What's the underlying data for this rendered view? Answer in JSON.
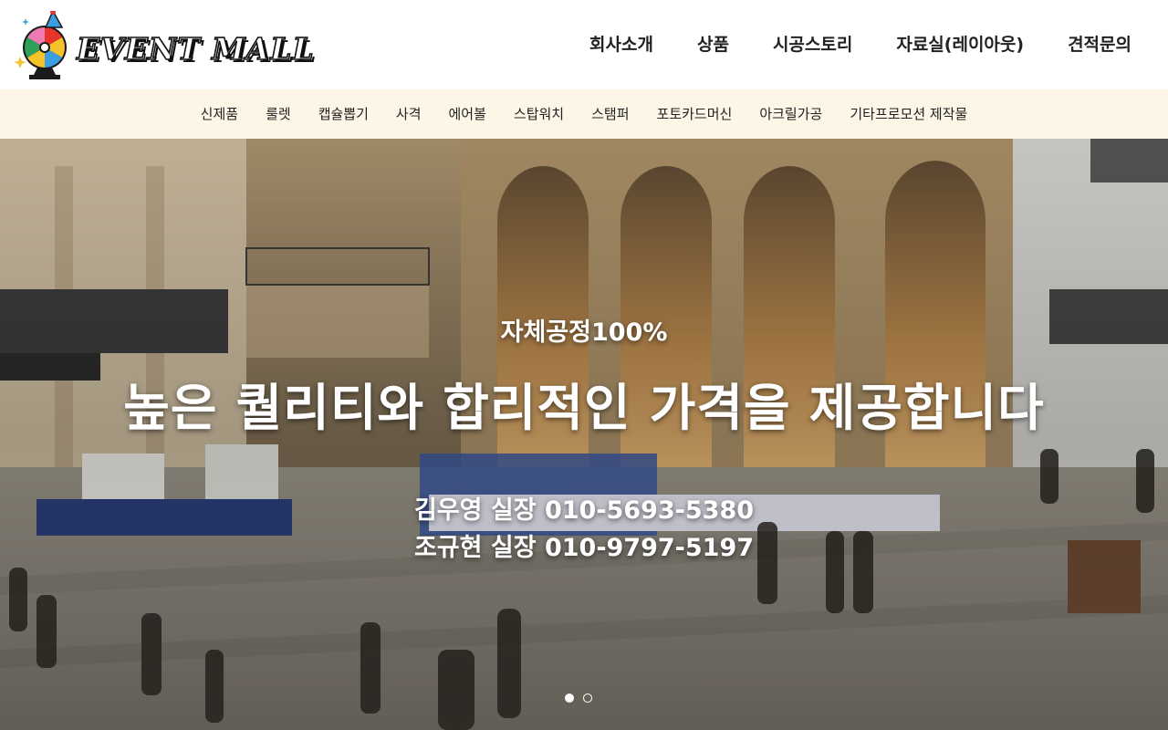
{
  "header": {
    "logo_text": "EVENT MALL",
    "nav": [
      {
        "label": "회사소개"
      },
      {
        "label": "상품"
      },
      {
        "label": "시공스토리"
      },
      {
        "label": "자료실(레이아웃)"
      },
      {
        "label": "견적문의"
      }
    ]
  },
  "subnav": {
    "items": [
      {
        "label": "신제품"
      },
      {
        "label": "룰렛"
      },
      {
        "label": "캡슐뽑기"
      },
      {
        "label": "사격"
      },
      {
        "label": "에어볼"
      },
      {
        "label": "스탑워치"
      },
      {
        "label": "스탬퍼"
      },
      {
        "label": "포토카드머신"
      },
      {
        "label": "아크릴가공"
      },
      {
        "label": "기타프로모션 제작물"
      }
    ]
  },
  "hero": {
    "subtitle": "자체공정100%",
    "title": "높은 퀄리티와 합리적인 가격을 제공합니다",
    "contacts": [
      "김우영 실장 010-5693-5380",
      "조규현 실장 010-9797-5197"
    ],
    "slides_total": 2,
    "active_slide": 1
  },
  "colors": {
    "subnav_bg": "#fdf6e6",
    "nav_text": "#222222",
    "hero_text": "#ffffff"
  }
}
